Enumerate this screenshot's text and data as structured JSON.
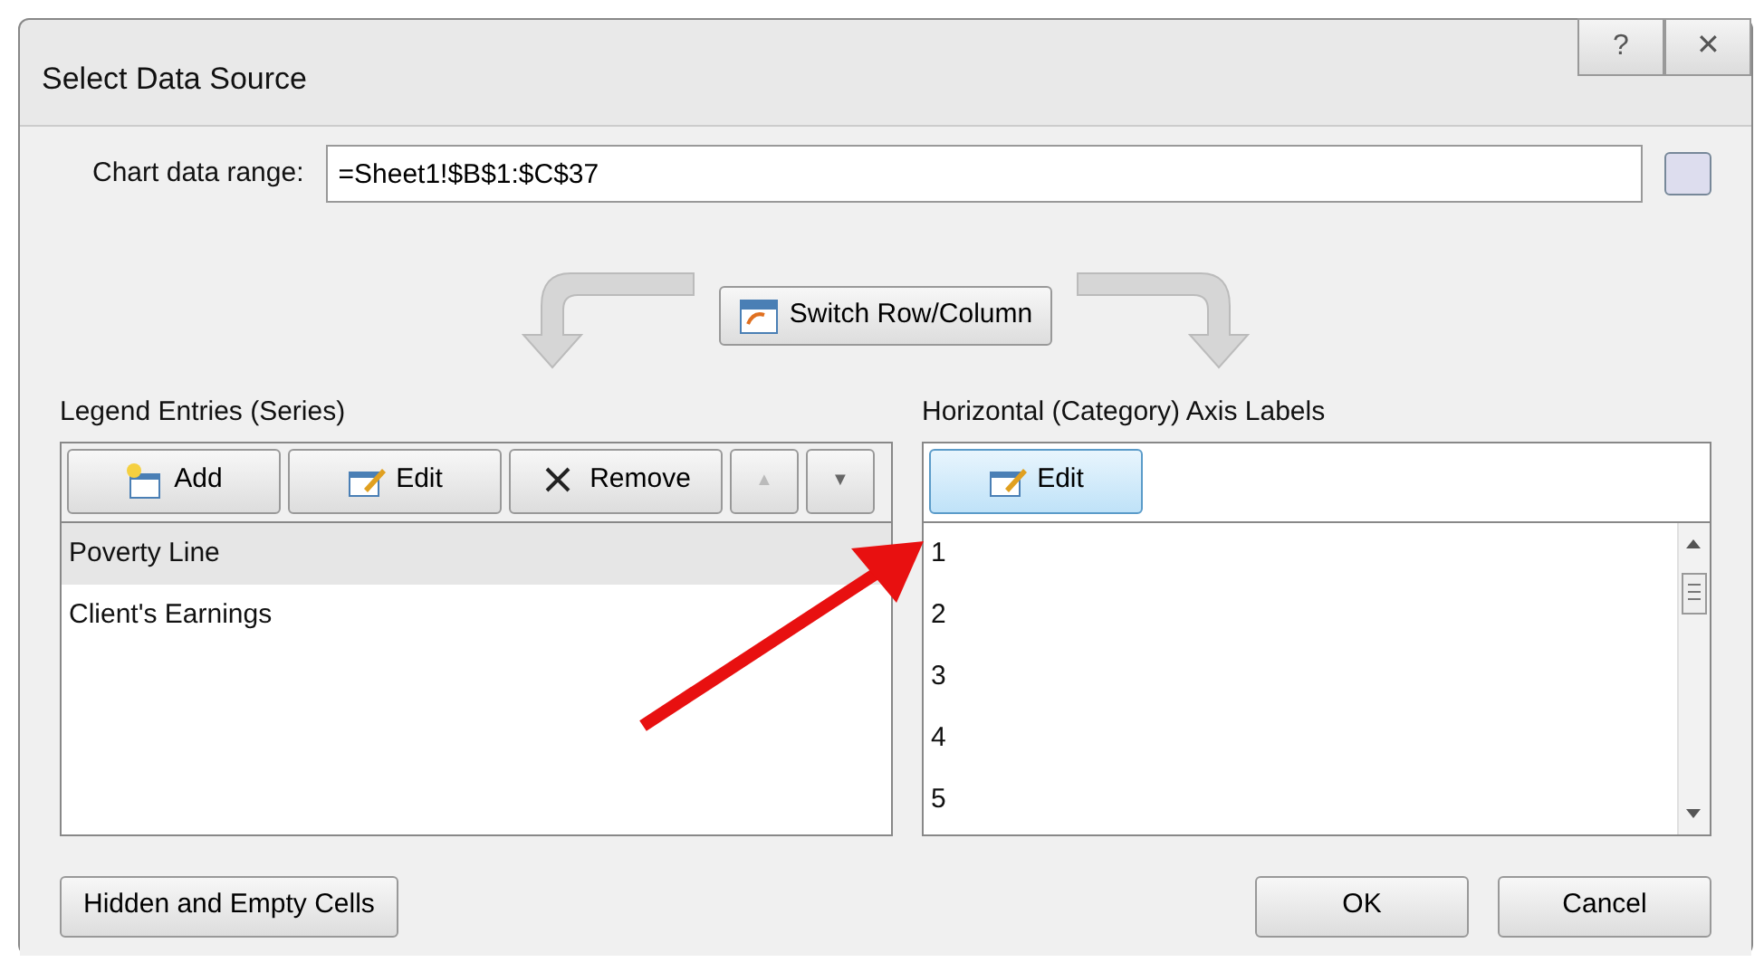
{
  "window": {
    "title": "Select Data Source",
    "buttons": [
      "?",
      "✕"
    ]
  },
  "chart_data_range": {
    "label": "Chart data range:",
    "value": "=Sheet1!$B$1:$C$37"
  },
  "switch_button": "Switch Row/Column",
  "legend_entries": {
    "label": "Legend Entries (Series)",
    "toolbar": [
      {
        "kind": "add",
        "label": "Add",
        "disabled": false
      },
      {
        "kind": "edit",
        "label": "Edit",
        "disabled": false
      },
      {
        "kind": "remove",
        "label": "Remove",
        "disabled": false
      },
      {
        "kind": "up",
        "label": "▲",
        "disabled": true
      },
      {
        "kind": "down",
        "label": "▼",
        "disabled": false
      }
    ],
    "items": [
      {
        "label": "Poverty Line",
        "selected": true
      },
      {
        "label": "Client's Earnings",
        "selected": false
      }
    ]
  },
  "axis_labels": {
    "label": "Horizontal (Category) Axis Labels",
    "edit_button": "Edit",
    "items": [
      "1",
      "2",
      "3",
      "4",
      "5"
    ]
  },
  "footer": {
    "hidden_cells_button": "Hidden and Empty Cells",
    "ok_button": "OK",
    "cancel_button": "Cancel"
  }
}
